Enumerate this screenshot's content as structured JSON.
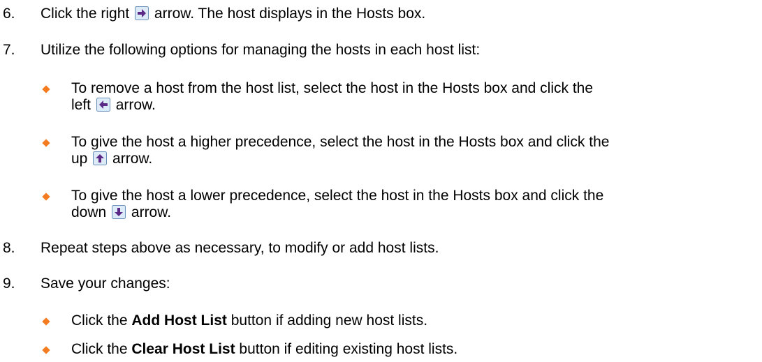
{
  "steps": {
    "s6": {
      "num": "6.",
      "before": "Click the right",
      "after": "arrow. The host displays in the Hosts box."
    },
    "s7": {
      "num": "7.",
      "text": "Utilize the following options for managing the hosts in each host list:"
    },
    "b1": {
      "line1": "To remove a host from the host list, select the host in the Hosts box and click the",
      "before": "left",
      "after": "arrow."
    },
    "b2": {
      "line1": "To give the host a higher precedence, select the host in the Hosts box and click the",
      "before": "up",
      "after": "arrow."
    },
    "b3": {
      "line1": "To give the host a lower precedence, select the host in the Hosts box and click the",
      "before": "down",
      "after": "arrow."
    },
    "s8": {
      "num": "8.",
      "text": "Repeat steps above as necessary, to modify or add host lists."
    },
    "s9": {
      "num": "9.",
      "text": "Save your changes:"
    },
    "b4": {
      "pre": "Click the",
      "bold": "Add Host List",
      "post": "button if adding new host lists."
    },
    "b5": {
      "pre": "Click the",
      "bold": "Clear Host List",
      "post": "button if editing existing host lists."
    }
  },
  "icons": {
    "right": "right-arrow-icon",
    "left": "left-arrow-icon",
    "up": "up-arrow-icon",
    "down": "down-arrow-icon"
  },
  "colors": {
    "bullet": "#f47b20",
    "arrow_fill": "#5b2a86",
    "arrow_button_bg": "#dcebf7",
    "arrow_button_border": "#6a8fb8"
  }
}
